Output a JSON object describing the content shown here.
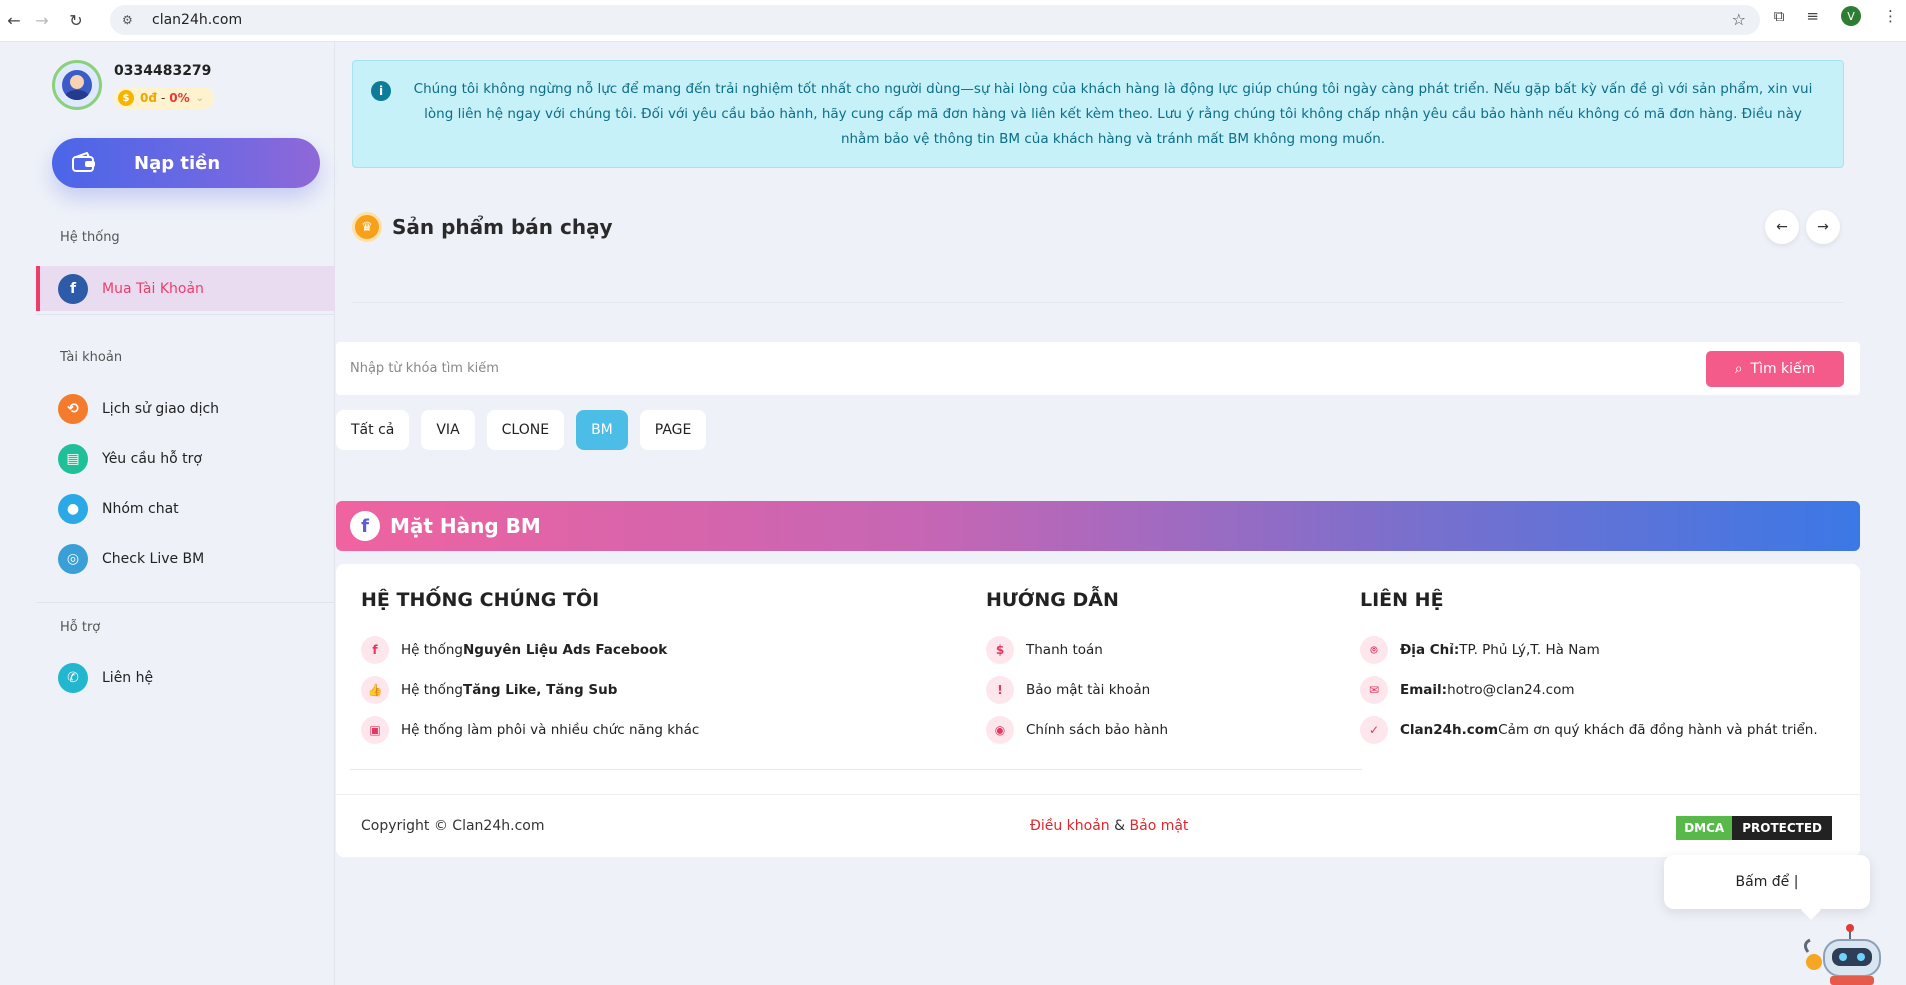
{
  "browser": {
    "url": "clan24h.com",
    "profile_initial": "V"
  },
  "user": {
    "phone": "0334483279",
    "balance": "0đ",
    "separator": "-",
    "discount": "0%"
  },
  "sidebar": {
    "topup_label": "Nạp tiền",
    "sections": {
      "system": "Hệ thống",
      "account": "Tài khoản",
      "support": "Hỗ trợ"
    },
    "items": {
      "buy_account": "Mua Tài Khoản",
      "transaction_history": "Lịch sử giao dịch",
      "support_request": "Yêu cầu hỗ trợ",
      "chat_group": "Nhóm chat",
      "check_live_bm": "Check Live BM",
      "contact": "Liên hệ"
    }
  },
  "notice": {
    "text": "Chúng tôi không ngừng nỗ lực để mang đến trải nghiệm tốt nhất cho người dùng—sự hài lòng của khách hàng là động lực giúp chúng tôi ngày càng phát triển. Nếu gặp bất kỳ vấn đề gì với sản phẩm, xin vui lòng liên hệ ngay với chúng tôi. Đối với yêu cầu bảo hành, hãy cung cấp mã đơn hàng và liên kết kèm theo. Lưu ý rằng chúng tôi không chấp nhận yêu cầu bảo hành nếu không có mã đơn hàng. Điều này nhằm bảo vệ thông tin BM của khách hàng và tránh mất BM không mong muốn."
  },
  "bestsellers": {
    "title": "Sản phẩm bán chạy"
  },
  "search": {
    "placeholder": "Nhập từ khóa tìm kiếm",
    "button_label": "Tìm kiếm"
  },
  "filters": {
    "all": "Tất cả",
    "via": "VIA",
    "clone": "CLONE",
    "bm": "BM",
    "page": "PAGE",
    "selected": "BM"
  },
  "category_banner": {
    "title": "Mặt Hàng BM"
  },
  "footer": {
    "col1": {
      "title": "HỆ THỐNG CHÚNG TÔI",
      "row1_prefix": "Hệ thống ",
      "row1_bold": "Nguyên Liệu Ads Facebook",
      "row2_prefix": "Hệ thống ",
      "row2_bold": "Tăng Like, Tăng Sub",
      "row3": "Hệ thống làm phôi và nhiều chức năng khác"
    },
    "col2": {
      "title": "HƯỚNG DẪN",
      "row1": "Thanh toán",
      "row2": "Bảo mật tài khoản",
      "row3": "Chính sách bảo hành"
    },
    "col3": {
      "title": "LIÊN HỆ",
      "address_label": "Địa Chỉ:",
      "address_value": " TP. Phủ Lý,T. Hà Nam",
      "email_label": "Email:",
      "email_value": " hotro@clan24.com",
      "brand": "Clan24h.com",
      "thanks": " Cảm ơn quý khách đã đồng hành và phát triển."
    },
    "copyright": "Copyright © Clan24h.com",
    "terms": "Điều khoản",
    "amp": " & ",
    "privacy": "Bảo mật",
    "dmca_left": "DMCA",
    "dmca_right": "PROTECTED"
  },
  "chat_bubble": {
    "text": "Bấm để |"
  },
  "colors": {
    "accent_pink": "#ee3d6a",
    "topup_gradient_start": "#4a66e8",
    "notice_bg": "#c6f1f8",
    "chip_active": "#4cbde6",
    "search_button": "#f45b8a"
  }
}
